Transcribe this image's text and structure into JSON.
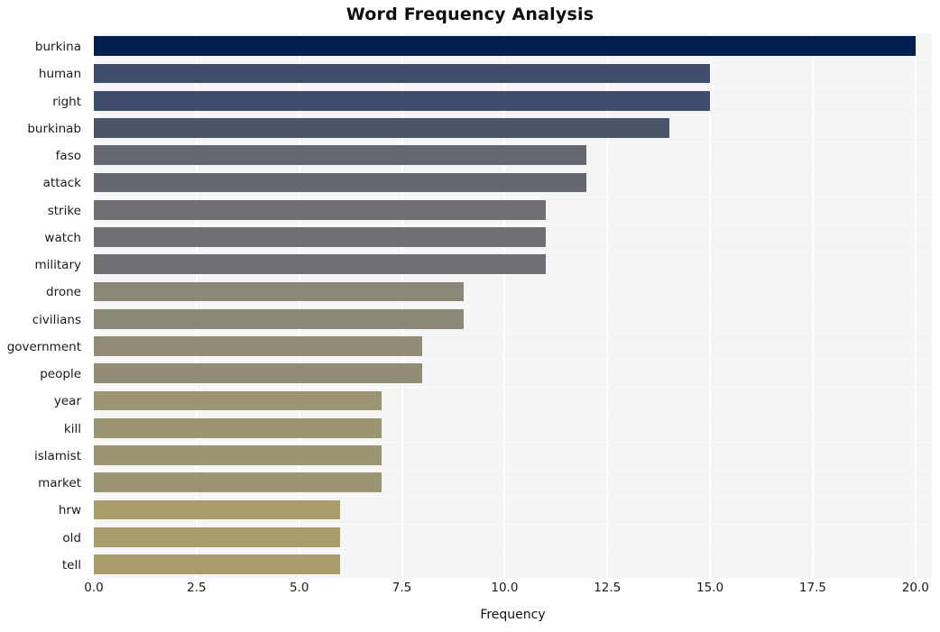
{
  "chart_data": {
    "type": "bar",
    "orientation": "horizontal",
    "title": "Word Frequency Analysis",
    "xlabel": "Frequency",
    "ylabel": "",
    "xlim": [
      0,
      20.4
    ],
    "ylim": [
      0,
      20
    ],
    "grid": true,
    "legend": null,
    "xticks": [
      "0.0",
      "2.5",
      "5.0",
      "7.5",
      "10.0",
      "12.5",
      "15.0",
      "17.5",
      "20.0"
    ],
    "xtick_values": [
      0,
      2.5,
      5,
      7.5,
      10,
      12.5,
      15,
      17.5,
      20
    ],
    "categories": [
      "burkina",
      "human",
      "right",
      "burkinab",
      "faso",
      "attack",
      "strike",
      "watch",
      "military",
      "drone",
      "civilians",
      "government",
      "people",
      "year",
      "kill",
      "islamist",
      "market",
      "hrw",
      "old",
      "tell"
    ],
    "values": [
      20,
      15,
      15,
      14,
      12,
      12,
      11,
      11,
      11,
      9,
      9,
      8,
      8,
      7,
      7,
      7,
      7,
      6,
      6,
      6
    ],
    "colors": [
      "#00214d",
      "#414d6e",
      "#414d6e",
      "#4b5468",
      "#656871",
      "#656871",
      "#6f7073",
      "#6f7073",
      "#6f7073",
      "#8b8878",
      "#8b8878",
      "#918d77",
      "#918d77",
      "#9b9572",
      "#9b9572",
      "#9b9572",
      "#9b9572",
      "#a99d6b",
      "#a99d6b",
      "#a99d6b"
    ],
    "plot_background": "#f5f5f5",
    "gridline_color": "#ffffff",
    "figure_background": "#ffffff"
  }
}
